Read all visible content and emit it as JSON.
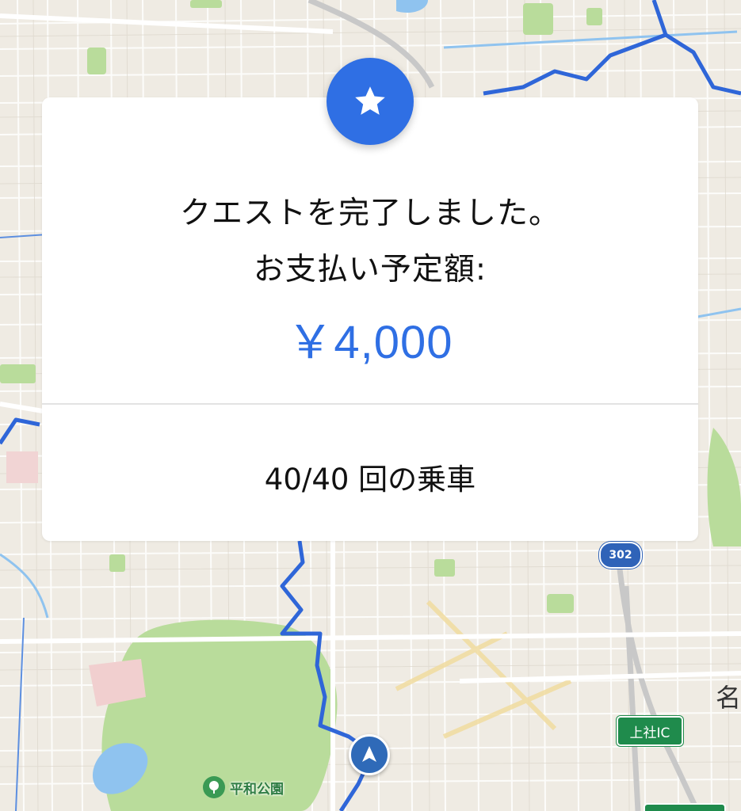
{
  "dialog": {
    "title_line1": "クエストを完了しました。",
    "title_line2": "お支払い予定額:",
    "amount": "￥4,000",
    "rides": "40/40 回の乗車",
    "badge_icon": "star-icon"
  },
  "map": {
    "route_number": "302",
    "ic_label": "上社IC",
    "park_label": "平和公園",
    "city_label": "名",
    "park_icon": "tree-icon",
    "location_icon": "navigation-arrow-icon"
  },
  "colors": {
    "accent": "#2f6fe4",
    "map_background": "#efebe3",
    "route_line": "#2f66d8",
    "park_green": "#b9dc9b",
    "water": "#8fc3ef"
  }
}
